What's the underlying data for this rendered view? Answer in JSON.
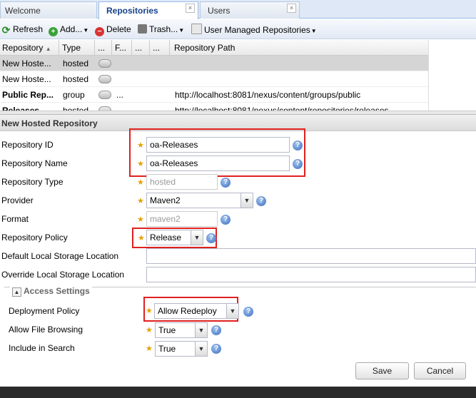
{
  "tabs": [
    {
      "label": "Welcome"
    },
    {
      "label": "Repositories",
      "close": "×"
    },
    {
      "label": "Users",
      "close": "×"
    }
  ],
  "toolbar": {
    "refresh": "Refresh",
    "add": "Add...",
    "delete": "Delete",
    "trash": "Trash...",
    "user_managed": "User Managed Repositories"
  },
  "grid": {
    "columns": [
      "Repository",
      "Type",
      "...",
      "F...",
      "...",
      "...",
      "Repository Path"
    ],
    "rows": [
      {
        "name": "New Hoste...",
        "type": "hosted",
        "path": ""
      },
      {
        "name": "New Hoste...",
        "type": "hosted",
        "path": ""
      },
      {
        "name": "Public Rep...",
        "type": "group",
        "extra": "...",
        "path": "http://localhost:8081/nexus/content/groups/public"
      },
      {
        "name": "Releases",
        "type": "hosted",
        "path": "http://localhost:8081/nexus/content/repositories/releases"
      }
    ]
  },
  "form": {
    "title": "New Hosted Repository",
    "repo_id": {
      "label": "Repository ID",
      "value": "oa-Releases"
    },
    "repo_name": {
      "label": "Repository Name",
      "value": "oa-Releases"
    },
    "repo_type": {
      "label": "Repository Type",
      "value": "hosted"
    },
    "provider": {
      "label": "Provider",
      "value": "Maven2"
    },
    "format": {
      "label": "Format",
      "value": "maven2"
    },
    "policy": {
      "label": "Repository Policy",
      "value": "Release"
    },
    "default_storage": {
      "label": "Default Local Storage Location",
      "value": ""
    },
    "override_storage": {
      "label": "Override Local Storage Location",
      "value": ""
    },
    "access": {
      "legend": "Access Settings",
      "deployment": {
        "label": "Deployment Policy",
        "value": "Allow Redeploy"
      },
      "browsing": {
        "label": "Allow File Browsing",
        "value": "True"
      },
      "search": {
        "label": "Include in Search",
        "value": "True"
      }
    },
    "save": "Save",
    "cancel": "Cancel"
  },
  "icons": {
    "help": "question-mark",
    "required": "star",
    "dropdown": "chevron-down"
  },
  "colors": {
    "highlight_box": "#e02020",
    "tab_active_text": "#15428b",
    "selected_row": "#d5d5d5"
  }
}
